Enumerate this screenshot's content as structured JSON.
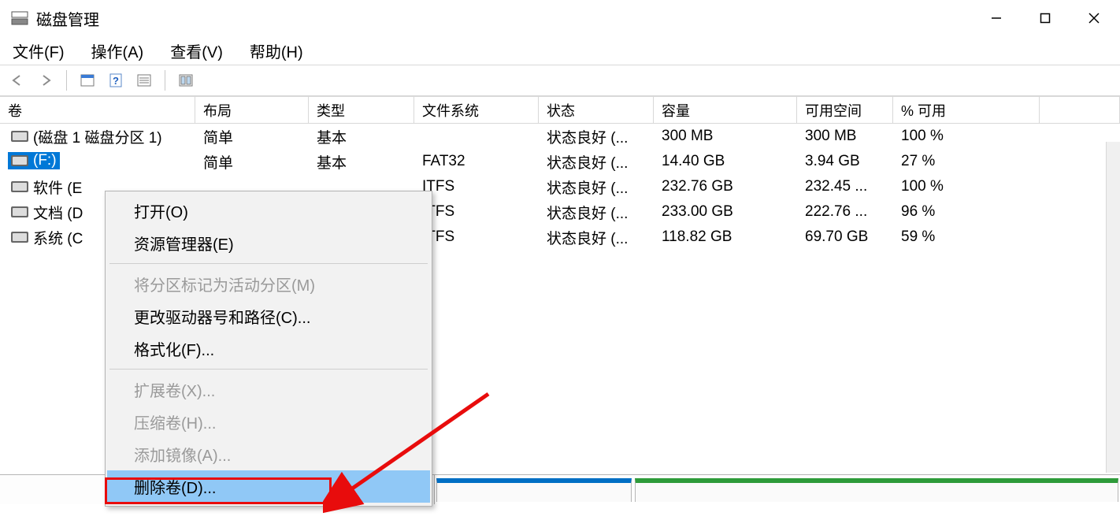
{
  "title": "磁盘管理",
  "menu": {
    "file": "文件(F)",
    "action": "操作(A)",
    "view": "查看(V)",
    "help": "帮助(H)"
  },
  "columns": [
    "卷",
    "布局",
    "类型",
    "文件系统",
    "状态",
    "容量",
    "可用空间",
    "% 可用"
  ],
  "rows": [
    {
      "vol": "(磁盘 1 磁盘分区 1)",
      "layout": "简单",
      "type": "基本",
      "fs": "",
      "status": "状态良好 (...",
      "cap": "300 MB",
      "free": "300 MB",
      "pct": "100 %",
      "selected": false
    },
    {
      "vol": "      (F:)",
      "layout": "简单",
      "type": "基本",
      "fs": "FAT32",
      "status": "状态良好 (...",
      "cap": "14.40 GB",
      "free": "3.94 GB",
      "pct": "27 %",
      "selected": true
    },
    {
      "vol": "软件 (E",
      "layout": "",
      "type": "",
      "fs": "ITFS",
      "status": "状态良好 (...",
      "cap": "232.76 GB",
      "free": "232.45 ...",
      "pct": "100 %",
      "selected": false
    },
    {
      "vol": "文档 (D",
      "layout": "",
      "type": "",
      "fs": "ITFS",
      "status": "状态良好 (...",
      "cap": "233.00 GB",
      "free": "222.76 ...",
      "pct": "96 %",
      "selected": false
    },
    {
      "vol": "系统 (C",
      "layout": "",
      "type": "",
      "fs": "ITFS",
      "status": "状态良好 (...",
      "cap": "118.82 GB",
      "free": "69.70 GB",
      "pct": "59 %",
      "selected": false
    }
  ],
  "context_menu": [
    {
      "label": "打开(O)",
      "enabled": true,
      "sep": false
    },
    {
      "label": "资源管理器(E)",
      "enabled": true,
      "sep": false
    },
    {
      "sep": true
    },
    {
      "label": "将分区标记为活动分区(M)",
      "enabled": false,
      "sep": false
    },
    {
      "label": "更改驱动器号和路径(C)...",
      "enabled": true,
      "sep": false
    },
    {
      "label": "格式化(F)...",
      "enabled": true,
      "sep": false
    },
    {
      "sep": true
    },
    {
      "label": "扩展卷(X)...",
      "enabled": false,
      "sep": false
    },
    {
      "label": "压缩卷(H)...",
      "enabled": false,
      "sep": false
    },
    {
      "label": "添加镜像(A)...",
      "enabled": false,
      "sep": false
    },
    {
      "label": "删除卷(D)...",
      "enabled": true,
      "sep": false,
      "highlight": true
    }
  ]
}
